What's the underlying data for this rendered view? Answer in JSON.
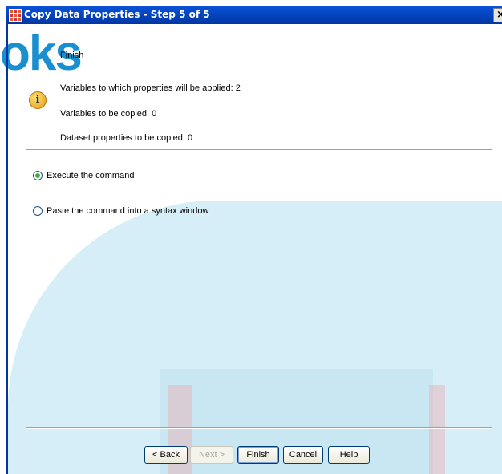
{
  "window": {
    "title": "Copy Data Properties - Step 5 of 5",
    "close_label": "×"
  },
  "watermark": {
    "text": "oks"
  },
  "info": {
    "icon": "info-icon",
    "glyph": "i"
  },
  "summary": {
    "heading": "Finish",
    "lines": [
      "Variables to which properties will be applied: 2",
      "Variables to be copied: 0",
      "Dataset properties to be copied: 0"
    ]
  },
  "options": [
    {
      "label": "Execute the command",
      "selected": true
    },
    {
      "label": "Paste the command into a syntax window",
      "selected": false
    }
  ],
  "buttons": {
    "back": "< Back",
    "next": "Next >",
    "finish": "Finish",
    "cancel": "Cancel",
    "help": "Help"
  },
  "colors": {
    "title_bar": "#0341b8",
    "radio_selected": "#3bb23b",
    "watermark": "#1a8fd0"
  }
}
